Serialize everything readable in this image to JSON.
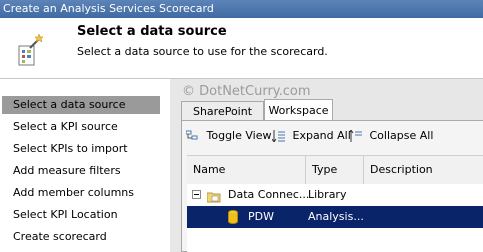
{
  "window": {
    "title": "Create an Analysis Services Scorecard"
  },
  "header": {
    "title": "Select a data source",
    "subtitle": "Select a data source to use for the scorecard."
  },
  "watermark": "© DotNetCurry.com",
  "nav": {
    "items": [
      {
        "label": "Select a data source",
        "active": true
      },
      {
        "label": "Select a KPI source"
      },
      {
        "label": "Select KPIs to import"
      },
      {
        "label": "Add measure filters"
      },
      {
        "label": "Add member columns"
      },
      {
        "label": "Select KPI Location"
      },
      {
        "label": "Create scorecard"
      }
    ]
  },
  "tabs": [
    {
      "label": "SharePoint Site"
    },
    {
      "label": "Workspace",
      "selected": true
    }
  ],
  "toolbar": {
    "toggle_view": "Toggle View",
    "expand_all": "Expand All",
    "collapse_all": "Collapse All"
  },
  "grid": {
    "columns": [
      "Name",
      "Type",
      "Description"
    ],
    "rows": [
      {
        "name": "Data Connec...",
        "type": "Library",
        "icon": "folder-icon"
      },
      {
        "name": "PDW",
        "type": "Analysis...",
        "icon": "cylinder-datasource-icon",
        "selected": true
      }
    ]
  },
  "colors": {
    "selection": "#0a246a",
    "nav_active": "#9a9a9a",
    "titlebar": "#4a74ab"
  }
}
